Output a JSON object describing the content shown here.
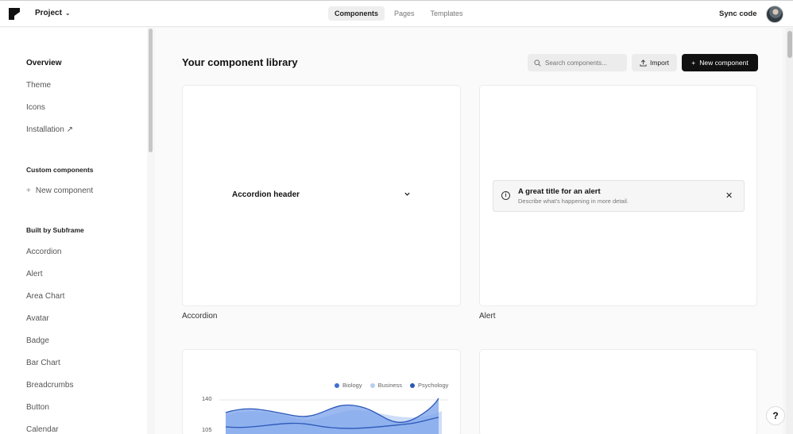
{
  "topbar": {
    "project_label": "Project",
    "tabs": [
      "Components",
      "Pages",
      "Templates"
    ],
    "active_tab": "Components",
    "sync_label": "Sync code"
  },
  "sidebar": {
    "top_items": [
      "Overview",
      "Theme",
      "Icons",
      "Installation ↗"
    ],
    "custom_heading": "Custom components",
    "new_component": "New component",
    "built_heading": "Built by Subframe",
    "built_items": [
      "Accordion",
      "Alert",
      "Area Chart",
      "Avatar",
      "Badge",
      "Bar Chart",
      "Breadcrumbs",
      "Button",
      "Calendar"
    ]
  },
  "main": {
    "title": "Your component library",
    "search_placeholder": "Search components...",
    "import_label": "Import",
    "new_component_label": "New component",
    "cards": [
      {
        "label": "Accordion"
      },
      {
        "label": "Alert"
      }
    ],
    "accordion": {
      "header": "Accordion header"
    },
    "alert": {
      "title": "A great title for an alert",
      "description": "Describe what's happening in more detail."
    },
    "area_chart": {
      "legend": [
        {
          "name": "Biology",
          "color": "#3f6fd6"
        },
        {
          "name": "Business",
          "color": "#b7cdf2"
        },
        {
          "name": "Psychology",
          "color": "#2c58b8"
        }
      ],
      "yticks": [
        "140",
        "105"
      ]
    }
  },
  "colors": {
    "accent": "#111111",
    "chart_blue": "#5b8be6",
    "chart_light": "#c6d8f7"
  }
}
